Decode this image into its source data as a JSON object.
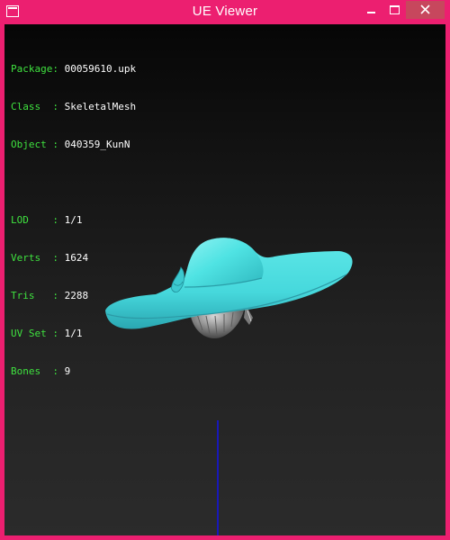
{
  "window": {
    "title": "UE Viewer",
    "controls": {
      "minimize": "minimize",
      "maximize": "maximize",
      "close": "close"
    }
  },
  "info": [
    {
      "key": "Package:",
      "value": "00059610.upk"
    },
    {
      "key": "Class  :",
      "value": "SkeletalMesh"
    },
    {
      "key": "Object :",
      "value": "040359_KunN"
    },
    {
      "key": "LOD    :",
      "value": "1/1"
    },
    {
      "key": "Verts  :",
      "value": "1624"
    },
    {
      "key": "Tris   :",
      "value": "2288"
    },
    {
      "key": "UV Set :",
      "value": "1/1"
    },
    {
      "key": "Bones  :",
      "value": "9"
    }
  ],
  "colors": {
    "titlebar": "#ec1f70",
    "close_button": "#c7475d",
    "label_green": "#3fe23f",
    "value_white": "#ffffff",
    "mesh_cyan": "#4fe3e3",
    "axis_blue": "#1818b8"
  },
  "icons": {
    "app": "app-window-icon",
    "minimize": "minimize-icon",
    "maximize": "maximize-icon",
    "close": "close-icon"
  }
}
